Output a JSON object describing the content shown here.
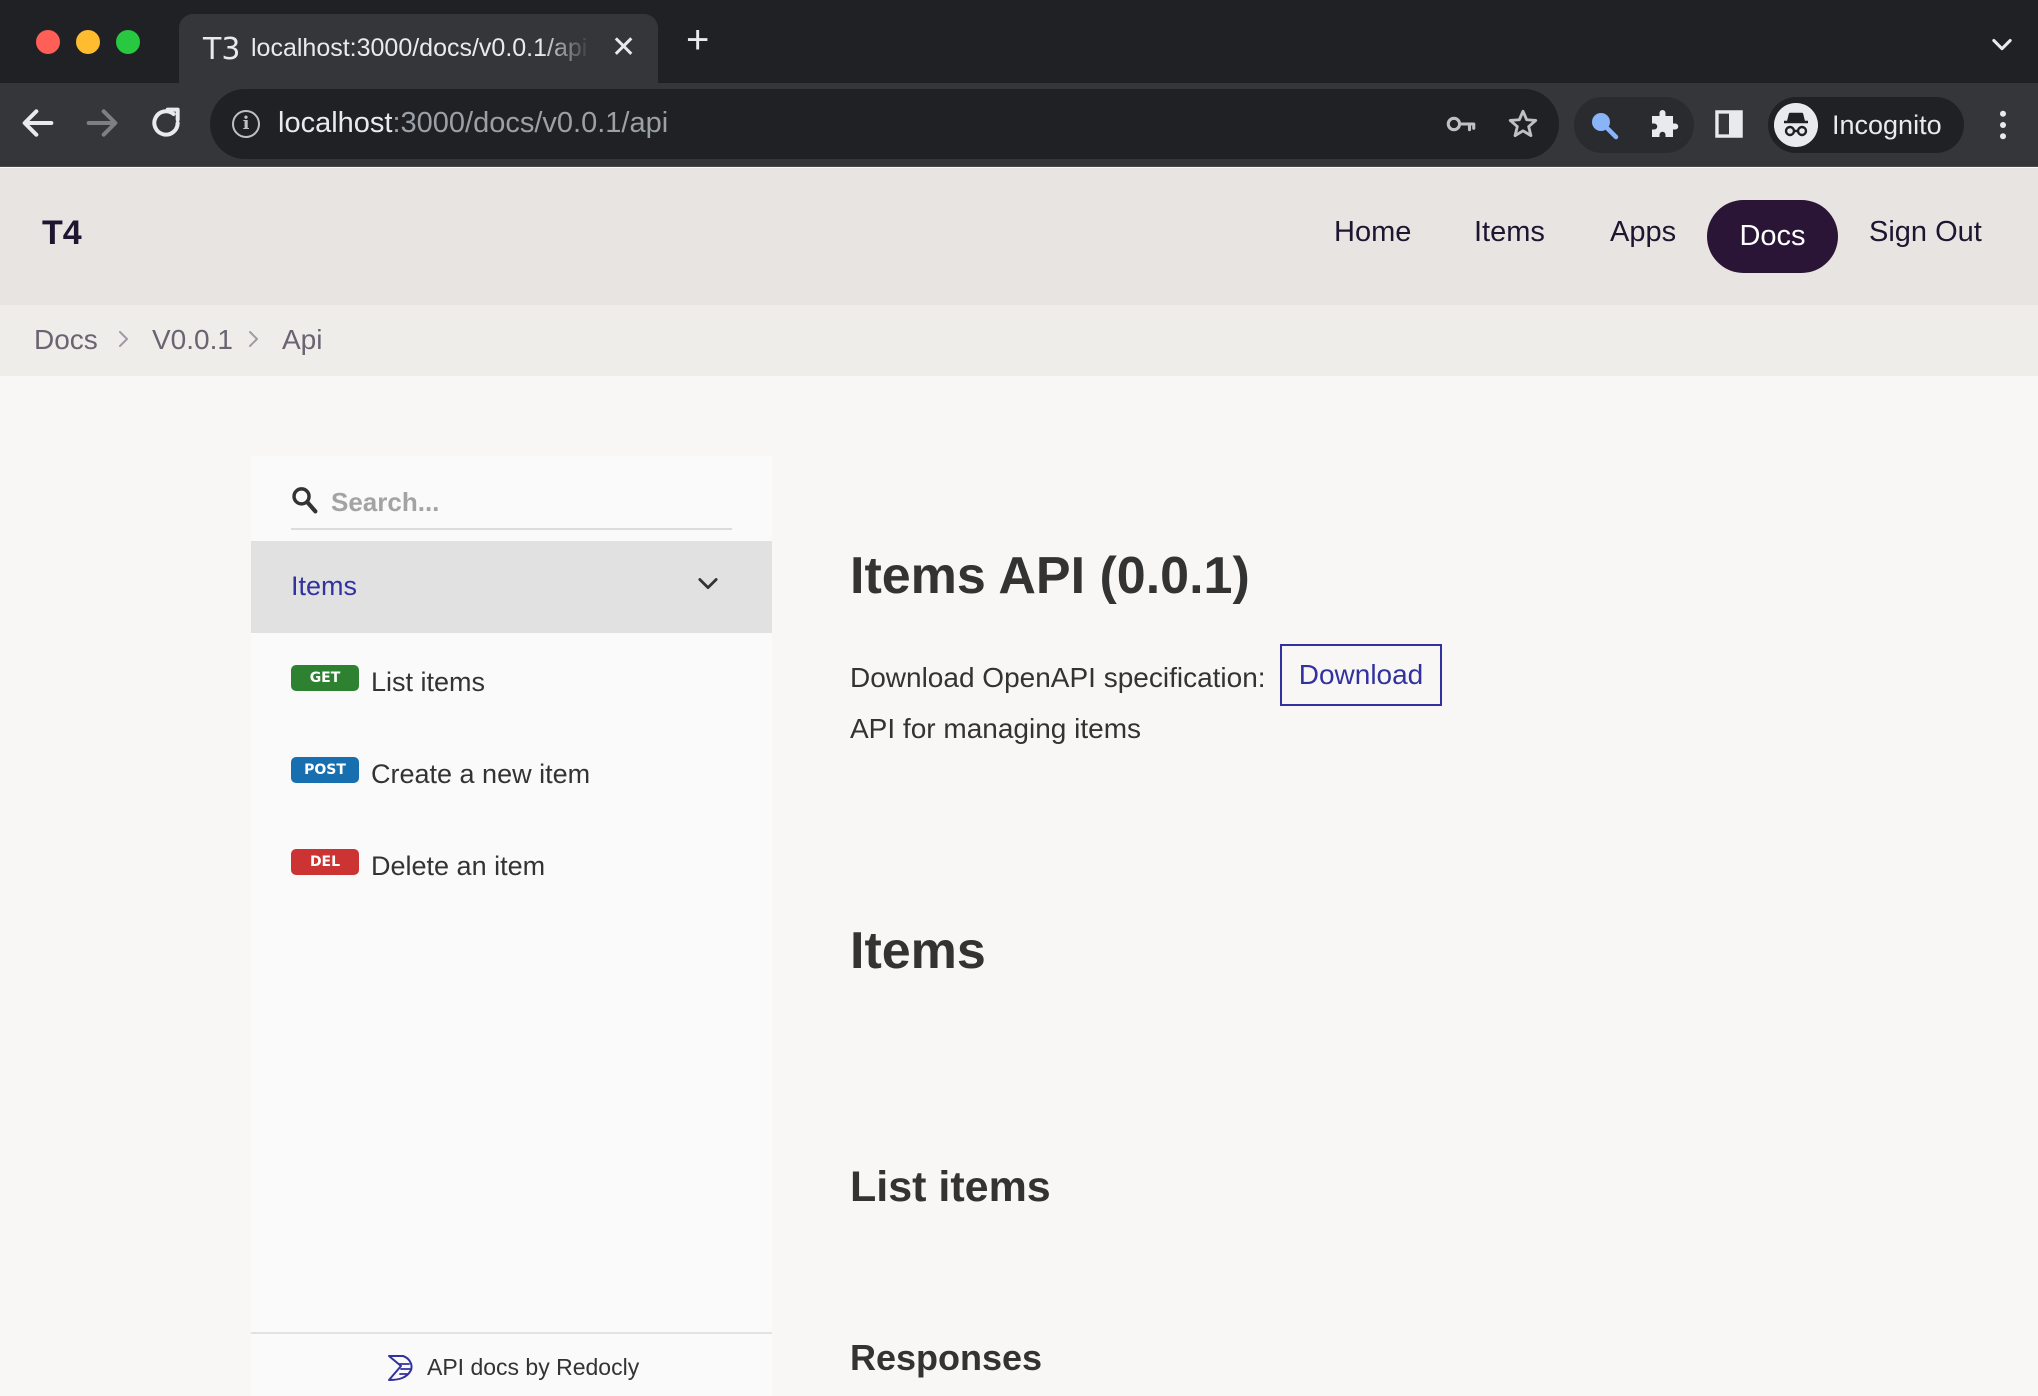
{
  "browser": {
    "tab": {
      "favicon": "T3",
      "title": "localhost:3000/docs/v0.0.1/api"
    },
    "address": {
      "host": "localhost",
      "path": ":3000/docs/v0.0.1/api"
    },
    "profile_label": "Incognito",
    "icons": [
      "back-icon",
      "forward-icon",
      "reload-icon",
      "info-icon",
      "key-icon",
      "star-icon",
      "lens-icon",
      "puzzle-icon",
      "side-panel-icon",
      "incognito-icon",
      "more-icon",
      "plus-icon",
      "close-icon",
      "chevron-down-icon"
    ]
  },
  "header": {
    "logo": "T4",
    "nav": [
      {
        "label": "Home",
        "active": false
      },
      {
        "label": "Items",
        "active": false
      },
      {
        "label": "Apps",
        "active": false
      },
      {
        "label": "Docs",
        "active": true
      },
      {
        "label": "Sign Out",
        "active": false
      }
    ],
    "active_color": "#2a1536"
  },
  "breadcrumb": [
    "Docs",
    "V0.0.1",
    "Api"
  ],
  "sidebar": {
    "search_placeholder": "Search...",
    "group": {
      "label": "Items",
      "expanded": true
    },
    "operations": [
      {
        "method": "GET",
        "label": "List items",
        "color": "#2f8132"
      },
      {
        "method": "POST",
        "label": "Create a new item",
        "color": "#186fb0"
      },
      {
        "method": "DEL",
        "label": "Delete an item",
        "color": "#cc3333"
      }
    ],
    "footer": "API docs by Redocly"
  },
  "main": {
    "title": "Items API (0.0.1)",
    "download_text": "Download OpenAPI specification:",
    "download_button": "Download",
    "description": "API for managing items",
    "section_title": "Items",
    "operation_title": "List items",
    "responses_title": "Responses",
    "link_color": "#32329f"
  }
}
